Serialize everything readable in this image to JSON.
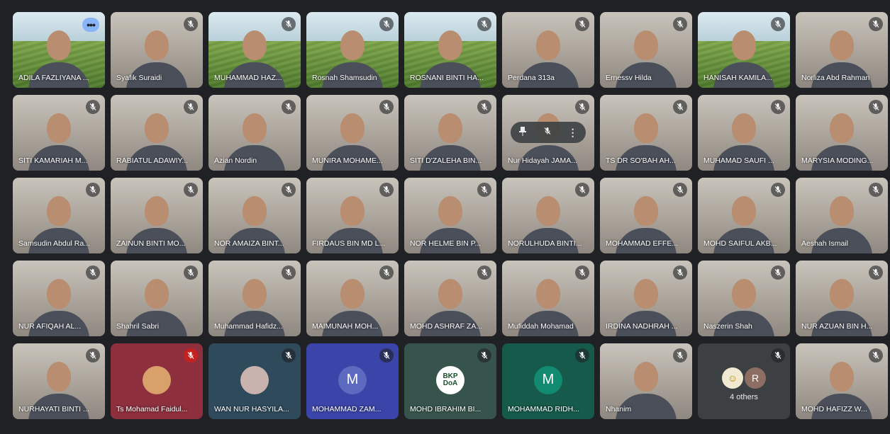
{
  "colors": {
    "background": "#202124",
    "tile": "#3c4043",
    "active_border": "#8ab4f8",
    "more_button": "#8ab4f8"
  },
  "participants": [
    {
      "name": "ADILA FAZLIYANA ...",
      "scene": "farm",
      "active": true,
      "more": "•••"
    },
    {
      "name": "Syafik Suraidi",
      "scene": "room"
    },
    {
      "name": "MUHAMMAD HAZ...",
      "scene": "farm"
    },
    {
      "name": "Rosnah Shamsudin",
      "scene": "farm"
    },
    {
      "name": "ROSNANI BINTI HA...",
      "scene": "farm"
    },
    {
      "name": "Perdana 313a",
      "scene": "room"
    },
    {
      "name": "Ernessv Hilda",
      "scene": "room"
    },
    {
      "name": "HANISAH KAMILA...",
      "scene": "farm"
    },
    {
      "name": "Norliza Abd Rahman",
      "scene": "room"
    },
    {
      "name": "SITI KAMARIAH M...",
      "scene": "room"
    },
    {
      "name": "RABIATUL ADAWIY...",
      "scene": "room"
    },
    {
      "name": "Azian Nordin",
      "scene": "room"
    },
    {
      "name": "MUNIRA MOHAME...",
      "scene": "room"
    },
    {
      "name": "SITI D'ZALEHA BIN...",
      "scene": "room"
    },
    {
      "name": "Nur Hidayah JAMA...",
      "scene": "room",
      "hover": true
    },
    {
      "name": "TS DR SO'BAH AH...",
      "scene": "room"
    },
    {
      "name": "MUHAMAD SAUFI ...",
      "scene": "room"
    },
    {
      "name": "MARYSIA MODING...",
      "scene": "room"
    },
    {
      "name": "Samsudin Abdul Ra...",
      "scene": "room"
    },
    {
      "name": "ZAINUN BINTI MO...",
      "scene": "room"
    },
    {
      "name": "NOR AMAIZA BINT...",
      "scene": "room"
    },
    {
      "name": "FIRDAUS BIN MD L...",
      "scene": "room"
    },
    {
      "name": "NOR HELME BIN P...",
      "scene": "room"
    },
    {
      "name": "NORULHUDA BINTI...",
      "scene": "room"
    },
    {
      "name": "MOHAMMAD EFFE...",
      "scene": "room"
    },
    {
      "name": "MOHD SAIFUL AKB...",
      "scene": "room"
    },
    {
      "name": "Aeshah Ismail",
      "scene": "room"
    },
    {
      "name": "NUR AFIQAH AL...",
      "scene": "room"
    },
    {
      "name": "Shahril Sabri",
      "scene": "room"
    },
    {
      "name": "Muhammad Hafidz...",
      "scene": "room"
    },
    {
      "name": "MAIMUNAH MOH...",
      "scene": "room"
    },
    {
      "name": "MOHD ASHRAF ZA...",
      "scene": "room"
    },
    {
      "name": "Mufiddah Mohamad",
      "scene": "room"
    },
    {
      "name": "IRDINA NADHRAH ...",
      "scene": "room"
    },
    {
      "name": "Naszerin Shah",
      "scene": "room"
    },
    {
      "name": "NUR AZUAN BIN H...",
      "scene": "room"
    },
    {
      "name": "NURHAYATI BINTI ...",
      "scene": "room"
    },
    {
      "name": "Ts Mohamad Faidul...",
      "scene": "avatar",
      "bg": "#8d2f3d",
      "avatar_bg": "#d8a06a",
      "avatar_text": "",
      "mic_red": true
    },
    {
      "name": "WAN NUR HASYILA...",
      "scene": "avatar",
      "bg": "#2f4a5b",
      "avatar_bg": "#c9b3ae",
      "avatar_text": ""
    },
    {
      "name": "MOHAMMAD ZAM...",
      "scene": "avatar",
      "bg": "#3b44a8",
      "avatar_bg": "#5c6bc0",
      "avatar_text": "M"
    },
    {
      "name": "MOHD IBRAHIM BI...",
      "scene": "avatar",
      "bg": "#37544c",
      "avatar_bg": "#ffffff",
      "avatar_text": "BKP DoA"
    },
    {
      "name": "MOHAMMAD RIDH...",
      "scene": "avatar",
      "bg": "#165a4c",
      "avatar_bg": "#128a6f",
      "avatar_text": "M"
    },
    {
      "name": "Nhanim",
      "scene": "room"
    },
    {
      "name": "",
      "scene": "others",
      "others_label": "4 others",
      "avatar_1": "☺",
      "avatar_2": "R"
    },
    {
      "name": "MOHD HAFIZZ W...",
      "scene": "room"
    }
  ]
}
